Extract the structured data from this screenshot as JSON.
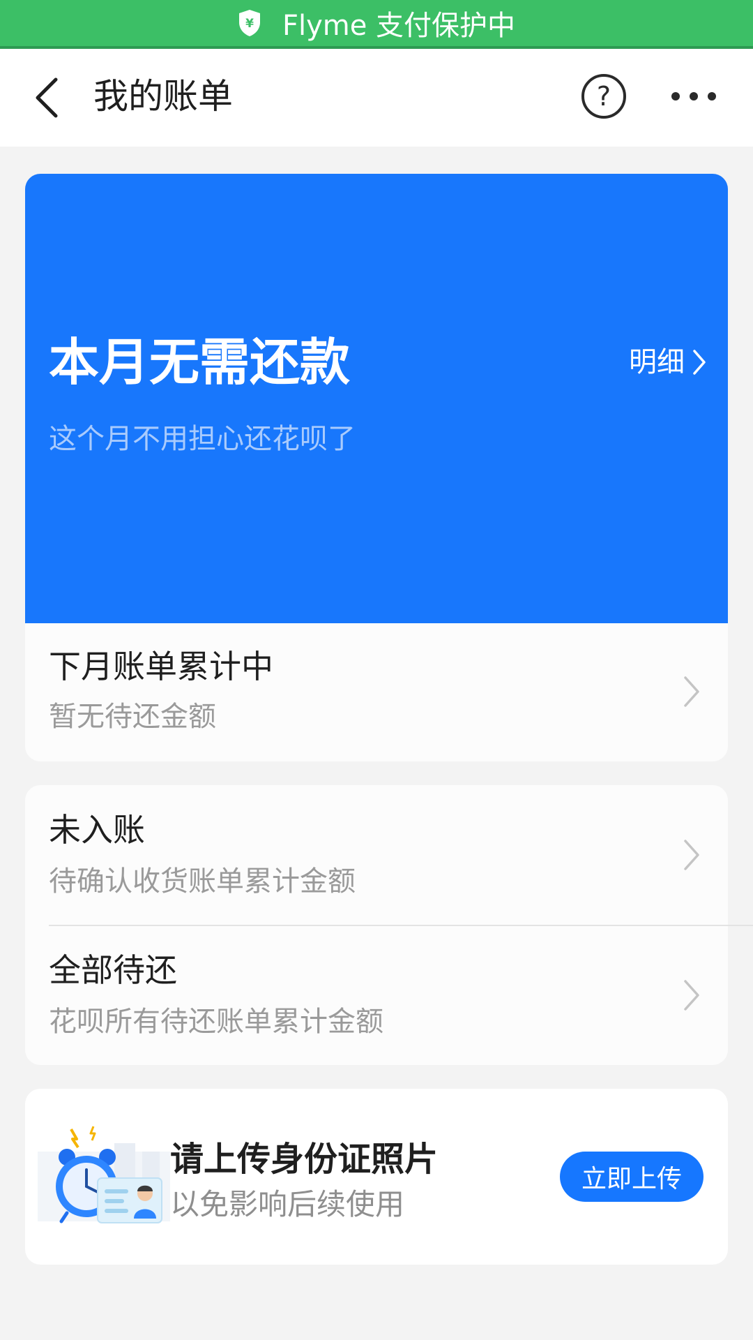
{
  "banner": {
    "text": "Flyme 支付保护中",
    "icon": "shield-yen-icon",
    "color": "#3cbf66"
  },
  "header": {
    "title": "我的账单",
    "back_icon": "back-arrow-icon",
    "help_icon": "help-icon",
    "more_icon": "more-icon"
  },
  "summary": {
    "title": "本月无需还款",
    "subtitle": "这个月不用担心还花呗了",
    "detail_label": "明细",
    "color": "#1877fc"
  },
  "next_month": {
    "title": "下月账单累计中",
    "subtitle": "暂无待还金额"
  },
  "bills": [
    {
      "title": "未入账",
      "subtitle": "待确认收货账单累计金额"
    },
    {
      "title": "全部待还",
      "subtitle": "花呗所有待还账单累计金额"
    }
  ],
  "upload": {
    "title": "请上传身份证照片",
    "subtitle": "以免影响后续使用",
    "button_label": "立即上传",
    "illustration": "alarm-clock-id-card-illustration"
  }
}
